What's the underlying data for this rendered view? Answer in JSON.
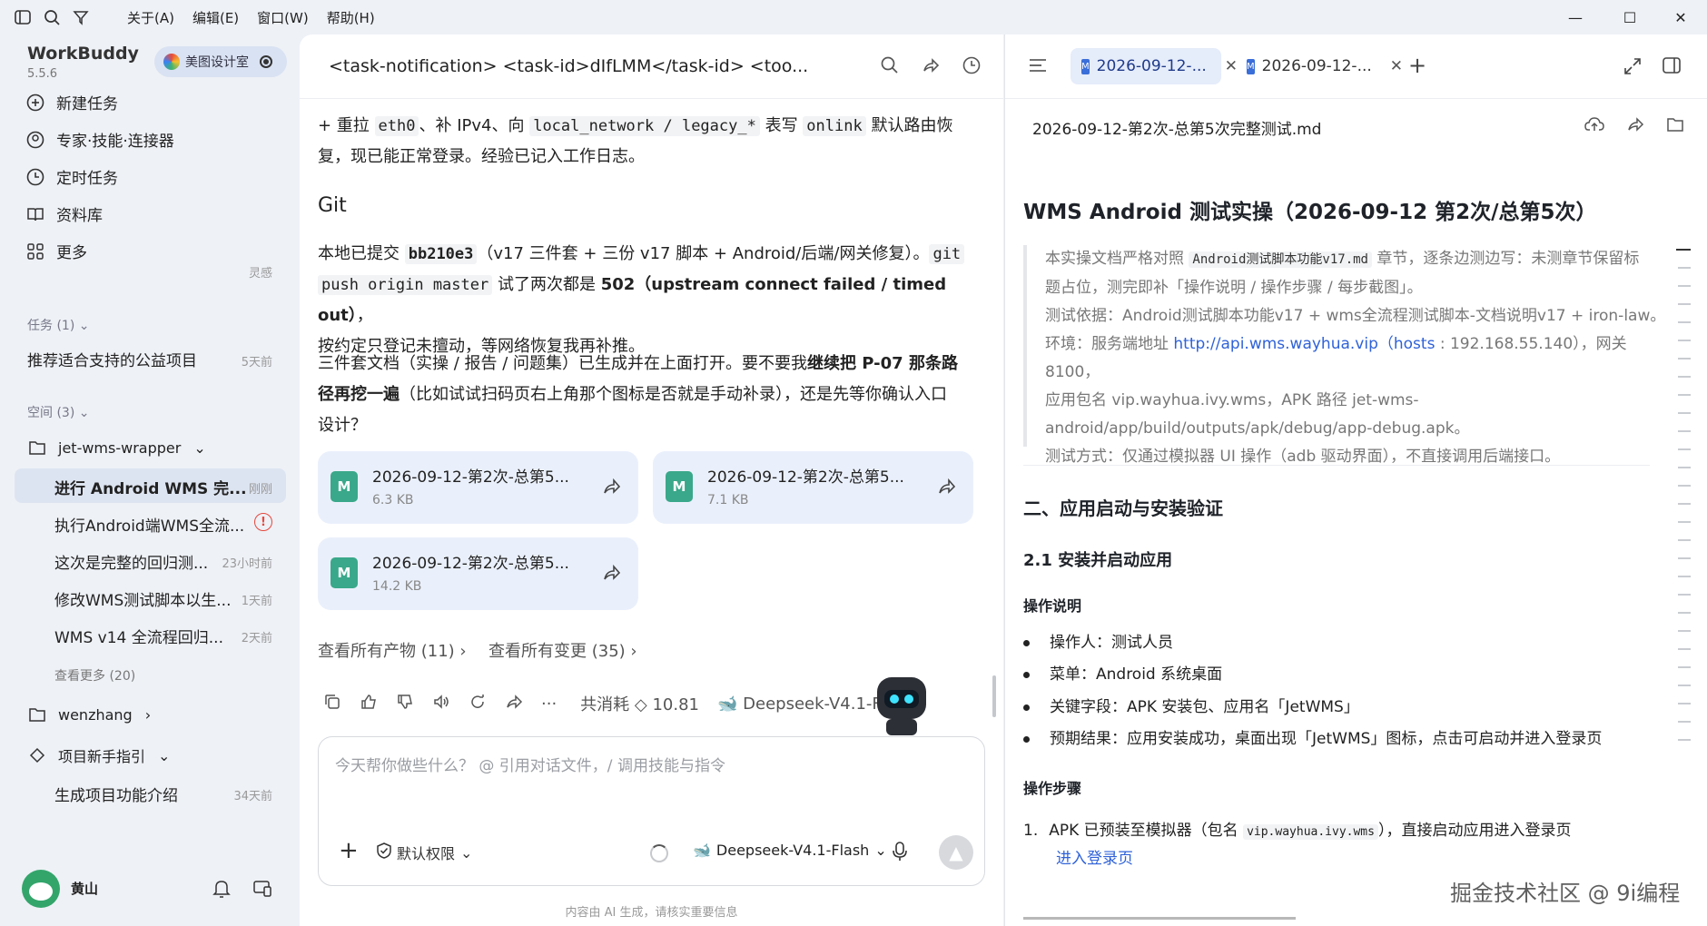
{
  "menu": [
    "关于(A)",
    "编辑(E)",
    "窗口(W)",
    "帮助(H)"
  ],
  "sidebar": {
    "brand": "WorkBuddy",
    "version": "5.5.6",
    "team": "美图设计室",
    "nav": [
      "新建任务",
      "专家·技能·连接器",
      "定时任务",
      "资料库",
      "更多"
    ],
    "more_badge": "灵感",
    "tasks_header": "任务 (1)",
    "task": {
      "label": "推荐适合支持的公益项目",
      "time": "5天前"
    },
    "spaces_header": "空间 (3)",
    "space1": "jet-wms-wrapper",
    "items": [
      {
        "label": "进行 Android WMS 完...",
        "time": "刚刚"
      },
      {
        "label": "执行Android端WMS全流...",
        "time": ""
      },
      {
        "label": "这次是完整的回归测...",
        "time": "23小时前"
      },
      {
        "label": "修改WMS测试脚本以生...",
        "time": "1天前"
      },
      {
        "label": "WMS v14 全流程回归...",
        "time": "2天前"
      }
    ],
    "see_more": "查看更多 (20)",
    "space2": "wenzhang",
    "space3": "项目新手指引",
    "space3_item": {
      "label": "生成项目功能介绍",
      "time": "34天前"
    },
    "user": "黄山"
  },
  "chat": {
    "title": "<task-notification> <task-id>dIfLMM</task-id> <too...",
    "p1a": "+ 重拉 ",
    "p1b": "eth0",
    "p1c": "、补 IPv4、向 ",
    "p1d": "local_network / legacy_*",
    "p1e": " 表写 ",
    "p1f": "onlink",
    "p1g": " 默认路由恢",
    "p1h": "复，现已能正常登录。经验已记入工作日志。",
    "git_heading": "Git",
    "p2a": "本地已提交 ",
    "p2b": "bb210e3",
    "p2c": "（v17 三件套 + 三份 v17 脚本 + Android/后端/网关修复）。",
    "p2d": "git",
    "p2e": "push origin master",
    "p2f": " 试了两次都是 ",
    "p2g": "502（upstream connect failed / timed out）",
    "p2h": "，",
    "p2i": "按约定只登记未擅动，等网络恢复我再补推。",
    "p3a": "三件套文档（实操 / 报告 / 问题集）已生成并在上面打开。要不要我",
    "p3b": "继续把 P-07 那条路",
    "p3c": "径再挖一遍",
    "p3d": "（比如试试扫码页右上角那个图标是否就是手动补录），还是先等你确认入口",
    "p3e": "设计？",
    "cards": [
      {
        "name": "2026-09-12-第2次-总第5...",
        "size": "6.3 KB"
      },
      {
        "name": "2026-09-12-第2次-总第5...",
        "size": "7.1 KB"
      },
      {
        "name": "2026-09-12-第2次-总第5...",
        "size": "14.2 KB"
      }
    ],
    "all_artifacts": "查看所有产物 (11)",
    "all_changes": "查看所有变更 (35)",
    "consumption": "共消耗 ◇ 10.81",
    "model_tag": "Deepseek-V4.1-Fla",
    "input_placeholder": "今天帮你做些什么？ @ 引用对话文件，/ 调用技能与指令",
    "permission": "默认权限",
    "model": "Deepseek-V4.1-Flash",
    "disclaimer": "内容由 AI 生成，请核实重要信息"
  },
  "panel": {
    "tab1": "2026-09-12-...",
    "tab2": "2026-09-12-...",
    "filename": "2026-09-12-第2次-总第5次完整测试.md",
    "h1": "WMS Android 测试实操（2026-09-12 第2次/总第5次）",
    "q1a": "本实操文档严格对照 ",
    "q1b": "Android测试脚本功能v17.md",
    "q1c": " 章节，逐条边测边写：未测章节保留标",
    "q2": "题占位，测完即补「操作说明 / 操作步骤 / 每步截图」。",
    "q3": "测试依据：Android测试脚本功能v17 + wms全流程测试脚本-文档说明v17 + iron-law。",
    "q4a": "环境：服务端地址 ",
    "q4b": "http://api.wms.wayhua.vip（hosts",
    "q4c": " : 192.168.55.140），网关 8100，",
    "q5": "应用包名 vip.wayhua.ivy.wms，APK 路径 jet-wms-",
    "q6": "android/app/build/outputs/apk/debug/app-debug.apk。",
    "q7": "测试方式：仅通过模拟器 UI 操作（adb 驱动界面），不直接调用后端接口。",
    "h2": "二、应用启动与安装验证",
    "h3": "2.1 安装并启动应用",
    "h4a": "操作说明",
    "bullets": [
      "操作人：测试人员",
      "菜单：Android 系统桌面",
      "关键字段：APK 安装包、应用名「JetWMS」",
      "预期结果：应用安装成功，桌面出现「JetWMS」图标，点击可启动并进入登录页"
    ],
    "h4b": "操作步骤",
    "step1a": "1.",
    "step1b": "APK 已预装至模拟器（包名 ",
    "step1c": "vip.wayhua.ivy.wms",
    "step1d": "），直接启动应用进入登录页",
    "step1link": "进入登录页",
    "watermark": "掘金技术社区 @ 9i编程"
  }
}
